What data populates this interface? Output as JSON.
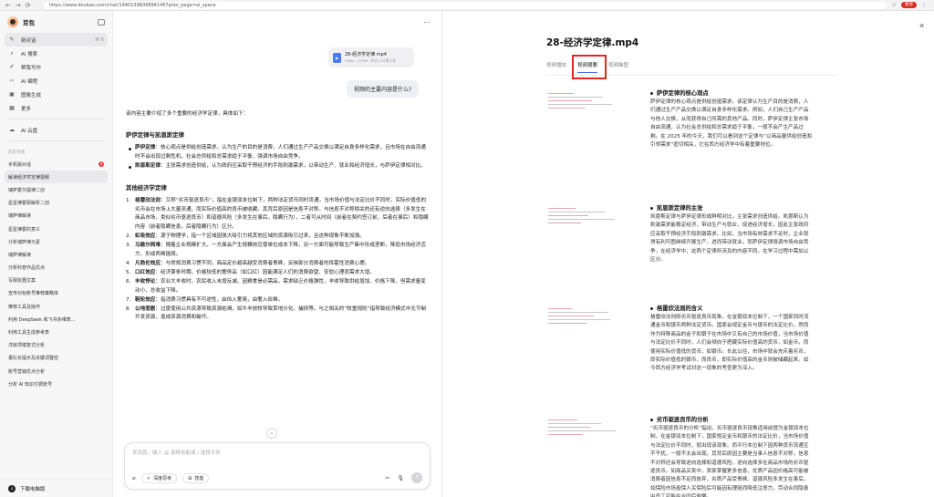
{
  "browser": {
    "url": "https://www.doubao.com/chat/14401396098941467prev_page=ai_space",
    "paused_label": "暂停"
  },
  "sidebar": {
    "app_name": "豆包",
    "nav": [
      {
        "label": "新对话",
        "icon": "chat-plus-icon",
        "extra": "⌘ K"
      },
      {
        "label": "AI 搜索",
        "icon": "search-icon"
      },
      {
        "label": "帮我写作",
        "icon": "pen-icon"
      },
      {
        "label": "AI 编程",
        "icon": "code-icon"
      },
      {
        "label": "图像生成",
        "icon": "image-icon"
      },
      {
        "label": "更多",
        "icon": "grid-icon"
      }
    ],
    "cloud_label": "AI 云盘",
    "history_title": "历史对话",
    "history": [
      "手机版对话",
      "解读经济学定律视频",
      "瑞萨霍尔提律二创",
      "星星律霍耶解析二创",
      "瑞萨律解读",
      "星星律霍的意义",
      "分析瑞萨律元素",
      "瑞萨律解读",
      "分析科普作品优点",
      "写朋友圈文案",
      "宣传对标账号推荐策略体",
      "推荐工具及操作",
      "利用 DeepSeek 和飞书多维表...",
      "利用工具生成参考表",
      "洋房项楼复式分析",
      "書队长提示及关键词警控",
      "账号营销优点分析",
      "分析 AI 知识付费账号"
    ],
    "history_badge": "3",
    "download_label": "下载电脑版"
  },
  "chat": {
    "file_name": "28-经济学定律.mp4",
    "file_meta": "Video · 27MB · 时长11分零十秒",
    "user_question": "视频的主要内容是什么?",
    "intro": "该内容主要介绍了多个重要的经济学定律，具体如下：",
    "section1_title": "萨伊定律与凯恩斯定律",
    "section1_items": [
      {
        "term": "萨伊定律",
        "text": "：核心观点是供给创造需求。认为生产的目的是消费，人们通过生产产品交换以满足自身多样化需求，且市场在自由流通时不会出现过剩危机，社会总供给和总需求趋于平衡，强调市场自由竞争。"
      },
      {
        "term": "凯恩斯定律",
        "text": "：主张需求创造供给，认为政府应采取干预经济的手段刺激需求，以带动生产、就业和经济增长，与萨伊定律相对比。"
      }
    ],
    "section2_title": "其他经济学定律",
    "section2_items": [
      {
        "num": "1.",
        "term": "格雷欣法则",
        "text": "：又称“劣币驱逐良币”，指在金银双本位制下，两种法定货币同时流通，当市场价值与法定比价不同时，实际价值低的劣币会在市场上大量流通，而实际价值高的良币被收藏。其背后原因是信息不对称。与信息不对称相关的还有逆向选择（多发生在商品市场，类似劣币驱逐良币）和道德风险（多发生在事后，隐瞒行为），二者可从时间（前者在契约签订前，后者在事后）和隐瞒内容（前者隐瞒信息，后者隐瞒行为）区分。"
      },
      {
        "num": "2.",
        "term": "虹吸效应",
        "text": "：源于物理学，指一个区域因强大吸引力将其他区域的资源吸引过来，且这种现象不断加强。"
      },
      {
        "num": "3.",
        "term": "马歇尔两难",
        "text": "：随着企业规模扩大，一方面会产生规模效应使单位成本下降，另一方面可能导致生产集中形成垄断，降低市场经济活力，形成两难困境。"
      },
      {
        "num": "4.",
        "term": "凡勃伦效应",
        "text": "：与常规消费习惯不同，商品定价越高越受消费者青睐，反映部分消费者的挥霍性消费心理。"
      },
      {
        "num": "5.",
        "term": "口红效应",
        "text": "：经济萧条时期，价格较低的奢侈品（如口红）因能满足人们的消费欲望、安慰心理而需求大增。"
      },
      {
        "num": "6.",
        "term": "丰收悖论",
        "text": "：农业大丰收时，农民收入未增反减。因粮食是必需品，需求缺乏价格弹性，丰收导致供给增加、价格下降，但需求量变动小，总收益下降。"
      },
      {
        "num": "7.",
        "term": "鞋轮效应",
        "text": "：指消费习惯具有不可逆性，由俭入奢易，由奢入俭难。"
      },
      {
        "num": "8.",
        "term": "公地悲剧",
        "text": "：过度使用公共资源导致资源枯竭，如牛羊放牧导致草地沙化、捕捞等。与之相关的“牧童规则”指导致经济模式中无节制开发资源，造成资源消费和破坏。"
      }
    ],
    "input_placeholder": "发消息、输入 @ 选择技能或 / 选择文件",
    "tool_deep_think": "深度思考",
    "tool_skills": "技能"
  },
  "panel": {
    "title": "28-经济学定律.mp4",
    "tabs": [
      "视频播放",
      "视频摘要",
      "视频脑图"
    ],
    "active_tab": 1,
    "highlight_color": "#e52620",
    "summaries": [
      {
        "title": "萨伊定律的核心观点",
        "text": "萨伊定律的核心观点是供给创造需求。该定律认为生产目的是消费，人们通过生产产品交换以满足自身多样化需求。例如，人们自己生产产品与他人交换，从而获得自己所需的其他产品。同时，萨伊定律主张市场自由流通，认为社会总供给和总需求趋于平衡，一般不会产生产品过剩。在 2025 年的今天，我们可以看到这个定律与“以商品量供给创造和引领需求”密切相关，它在西方经济学中有着重要地位。"
      },
      {
        "title": "凯恩斯定律的主张",
        "text": "凯恩斯定律与萨伊定律形成鲜明对比，主张需求创造供给。凯恩斯认为刺激需求能稳定经济，带动生产与就业，促进经济增长，因此主张政府应采取干预经济手段刺激需求。比如，当市场有效需求不足时，企业就得有利可图继续开展生产，进而带动就业。而萨伊定律强调市场自由竞争，在经济学中，这两个定律所涉及的内容不同，在学习过程中需加以区分。"
      },
      {
        "title": "格雷欣法则的含义",
        "text": "格雷欣法则即劣币驱逐良币现象。在金银双本位制下，一个国家同时流通金币和银币两种法定货币。国家会规定金币与银币的法定比价，然而作为特殊商品的金子和银子在市场中又有自己的市场价值，当市场价值与法定比价不同时，人们会倾向于把藏实际价值高的货币，如金币，而使用实际价值低的货币，如银币。长此以往，市场中就会充斥着劣币，即实际价值低的银币，而良币，即实际价值高的金币则被储藏起来。如今西方经济学考试对这一现象的考查更为深入。"
      },
      {
        "title": "劣币驱逐良币的分析",
        "text": "“劣币驱逐良币的分析”指出，劣币驱逐良币现象适用前提为金银双本位制，在金银双本位制下，国家规定金币和银币的法定比价，当市场价值与法定比价不同时，就出现该现象。而平行本位制下因两种货币流通互不干扰，一般不太会出现。其背后原因主要是当事人信息不对称，信息不对称还会导致逆向选择和道德风险。逆向选择多在商品市场的劣币驱逐良币。如商品买卖中，卖家掌握更多信息，优质产品因价格高可能被消费者因信息不足而放弃，劣质产品受青睐。道德风险多发生在事后，如保险市场投保人买保险后可能因有理赔而降低注意力，劳动合同隐患中员工可能在合同后偷懒。"
      }
    ]
  }
}
